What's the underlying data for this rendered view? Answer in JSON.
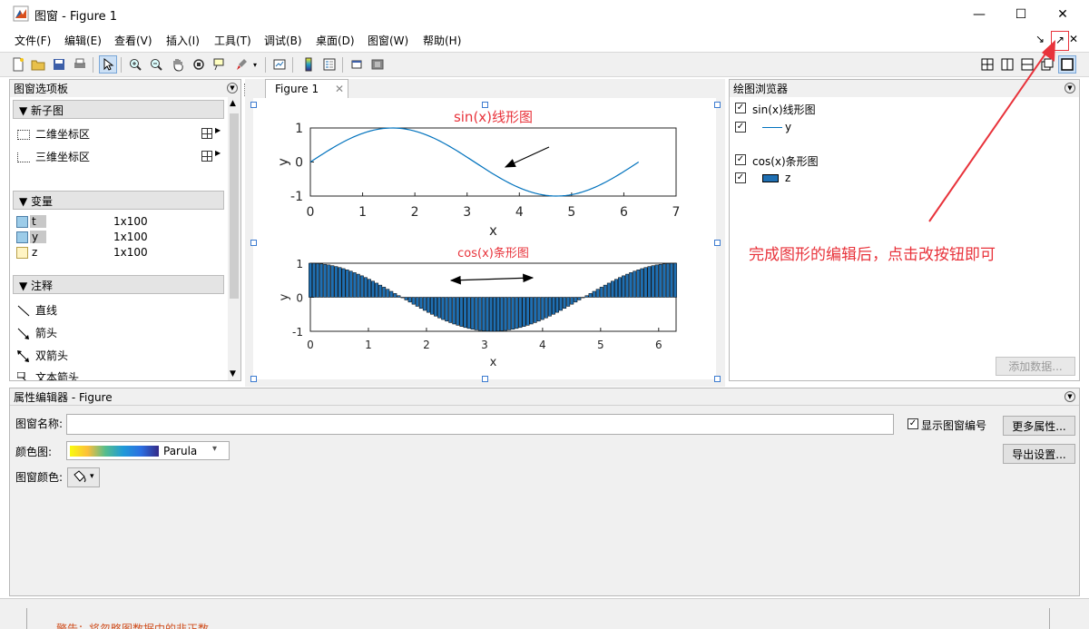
{
  "window": {
    "title": "图窗 - Figure 1",
    "minimize_glyph": "—",
    "maximize_glyph": "☐",
    "close_glyph": "✕"
  },
  "menus": [
    "文件(F)",
    "编辑(E)",
    "查看(V)",
    "插入(I)",
    "工具(T)",
    "调试(B)",
    "桌面(D)",
    "图窗(W)",
    "帮助(H)"
  ],
  "dock_controls": {
    "undock_glyph": "↘",
    "dock_glyph": "↗",
    "close_glyph": "✕"
  },
  "toolbar_icons": [
    "new-figure-icon",
    "open-icon",
    "save-icon",
    "print-icon",
    "pointer-icon",
    "zoom-in-icon",
    "zoom-out-icon",
    "pan-icon",
    "rotate-3d-icon",
    "data-cursor-icon",
    "brush-icon",
    "link-plot-icon",
    "colorbar-icon",
    "legend-icon",
    "hide-plot-tools-icon",
    "show-plot-tools-icon"
  ],
  "layout_icons": [
    "tile-layout-icon",
    "left-right-layout-icon",
    "top-bottom-layout-icon",
    "float-layout-icon",
    "maximize-layout-icon"
  ],
  "palette": {
    "title": "图窗选项板",
    "sections": {
      "subplot": "新子图",
      "variables": "变量",
      "annotations": "注释"
    },
    "subplot_items": [
      "二维坐标区",
      "三维坐标区"
    ],
    "variables": [
      {
        "name": "t",
        "size": "1x100"
      },
      {
        "name": "y",
        "size": "1x100"
      },
      {
        "name": "z",
        "size": "1x100"
      }
    ],
    "annotations": [
      "直线",
      "箭头",
      "双箭头",
      "文本箭头"
    ]
  },
  "figure_tab": {
    "label": "Figure 1",
    "close_glyph": "✕"
  },
  "browser": {
    "title": "绘图浏览器",
    "items": [
      {
        "label": "sin(x)线形图",
        "child": "y"
      },
      {
        "label": "cos(x)条形图",
        "child": "z"
      }
    ],
    "add_data_label": "添加数据..."
  },
  "callout": {
    "text": "完成图形的编辑后，点击改按钮即可",
    "color": "#e8333b"
  },
  "property_editor": {
    "title": "属性编辑器 - Figure",
    "figure_name_label": "图窗名称:",
    "figure_name_value": "",
    "show_number_label": "显示图窗编号",
    "more_props_label": "更多属性...",
    "colormap_label": "颜色图:",
    "colormap_value": "Parula",
    "export_label": "导出设置...",
    "figure_color_label": "图窗颜色:"
  },
  "status_warning": "警告：将忽略图数据中的非正数。",
  "chart_data": [
    {
      "type": "line",
      "title": "sin(x)线形图",
      "xlabel": "x",
      "ylabel": "y",
      "xlim": [
        0,
        7
      ],
      "ylim": [
        -1,
        1
      ],
      "xticks": [
        0,
        1,
        2,
        3,
        4,
        5,
        6,
        7
      ],
      "yticks": [
        -1,
        0,
        1
      ],
      "function": "sin",
      "domain": [
        0,
        6.2832
      ],
      "points": 100,
      "color": "#0072bd",
      "annotation": "arrow"
    },
    {
      "type": "bar",
      "title": "cos(x)条形图",
      "xlabel": "x",
      "ylabel": "y",
      "xlim": [
        0,
        6.3
      ],
      "ylim": [
        -1,
        1
      ],
      "xticks": [
        0,
        1,
        2,
        3,
        4,
        5,
        6
      ],
      "yticks": [
        -1,
        0,
        1
      ],
      "function": "cos",
      "domain": [
        0,
        6.2832
      ],
      "points": 100,
      "color": "#1f6fb2",
      "annotation": "double-arrow"
    }
  ]
}
